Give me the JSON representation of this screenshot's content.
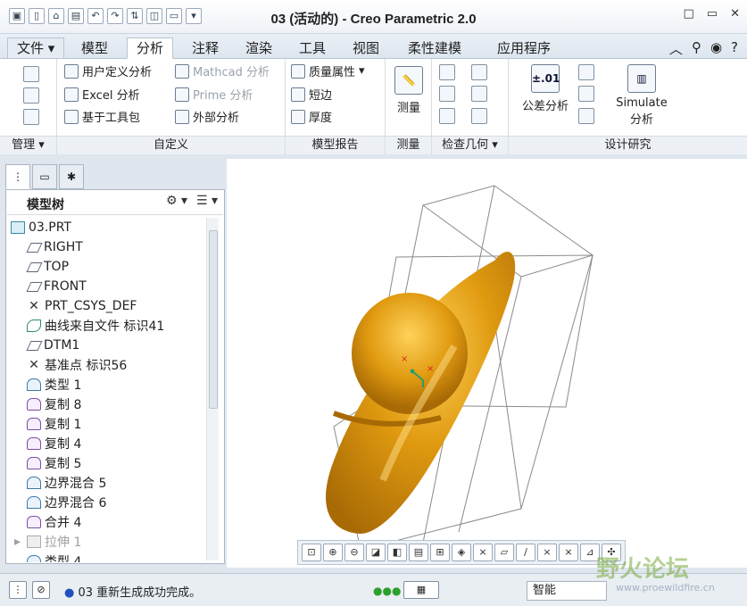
{
  "title": "03 (活动的) - Creo Parametric 2.0",
  "window_buttons": [
    "□",
    "▭",
    "✕"
  ],
  "tabs": [
    {
      "label": "文件",
      "state": "file"
    },
    {
      "label": "模型",
      "state": "normal"
    },
    {
      "label": "分析",
      "state": "active"
    },
    {
      "label": "注释",
      "state": "normal"
    },
    {
      "label": "渲染",
      "state": "normal"
    },
    {
      "label": "工具",
      "state": "normal"
    },
    {
      "label": "视图",
      "state": "normal"
    },
    {
      "label": "柔性建模",
      "state": "normal"
    },
    {
      "label": "应用程序",
      "state": "normal"
    }
  ],
  "ribbon": {
    "groups": {
      "manage": "管理",
      "custom": "自定义",
      "model_report": "模型报告",
      "measure": "测量",
      "inspect_geometry": "检查几何",
      "design_study": "设计研究"
    },
    "custom_items": {
      "user_defined": "用户定义分析",
      "excel": "Excel 分析",
      "toolkit": "基于工具包",
      "mathcad": "Mathcad 分析",
      "prime": "Prime 分析",
      "external": "外部分析"
    },
    "model_report_items": {
      "mass_props": "质量属性",
      "short_edge": "短边",
      "thickness": "厚度"
    },
    "measure_label": "测量",
    "tolerance": {
      "icon_text": "±.01",
      "label": "公差分析"
    },
    "simulate": {
      "line1": "Simulate",
      "line2": "分析"
    }
  },
  "panel": {
    "tree_header": "模型树",
    "items": [
      {
        "label": "03.PRT",
        "icon": "part",
        "indent": 0,
        "disabled": false
      },
      {
        "label": "RIGHT",
        "icon": "plane",
        "indent": 1,
        "disabled": false
      },
      {
        "label": "TOP",
        "icon": "plane",
        "indent": 1,
        "disabled": false
      },
      {
        "label": "FRONT",
        "icon": "plane",
        "indent": 1,
        "disabled": false
      },
      {
        "label": "PRT_CSYS_DEF",
        "icon": "csys",
        "indent": 1,
        "disabled": false
      },
      {
        "label": "曲线来自文件 标识41",
        "icon": "curve",
        "indent": 1,
        "disabled": false
      },
      {
        "label": "DTM1",
        "icon": "plane",
        "indent": 1,
        "disabled": false
      },
      {
        "label": "基准点 标识56",
        "icon": "csys",
        "indent": 1,
        "disabled": false
      },
      {
        "label": "类型 1",
        "icon": "quilt",
        "indent": 1,
        "disabled": false
      },
      {
        "label": "复制 8",
        "icon": "feat",
        "indent": 1,
        "disabled": false
      },
      {
        "label": "复制 1",
        "icon": "feat",
        "indent": 1,
        "disabled": false
      },
      {
        "label": "复制 4",
        "icon": "feat",
        "indent": 1,
        "disabled": false
      },
      {
        "label": "复制 5",
        "icon": "feat",
        "indent": 1,
        "disabled": false
      },
      {
        "label": "边界混合 5",
        "icon": "quilt",
        "indent": 1,
        "disabled": false
      },
      {
        "label": "边界混合 6",
        "icon": "quilt",
        "indent": 1,
        "disabled": false
      },
      {
        "label": "合并 4",
        "icon": "feat",
        "indent": 1,
        "disabled": false
      },
      {
        "label": "拉伸 1",
        "icon": "dis",
        "indent": 1,
        "disabled": true
      },
      {
        "label": "类型 4",
        "icon": "quilt",
        "indent": 1,
        "disabled": false
      }
    ]
  },
  "status": {
    "message": "03 重新生成成功完成。",
    "filter": "智能"
  },
  "watermark": {
    "text": "野火论坛",
    "url": "www.proewildfire.cn"
  },
  "colors": {
    "model": "#e09a10",
    "model_dark": "#a86a05",
    "model_light": "#ffd25a",
    "frame": "#8a8a8a"
  }
}
